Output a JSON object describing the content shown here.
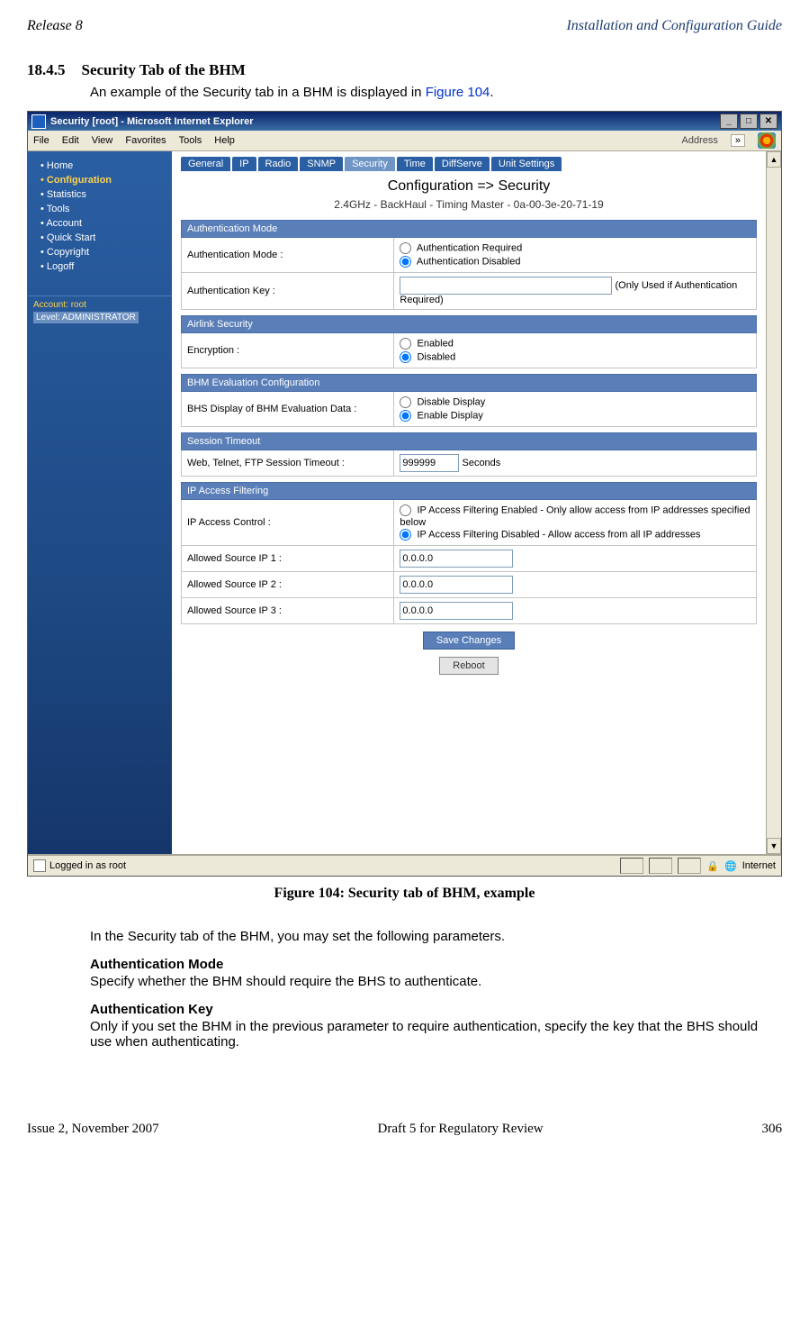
{
  "header": {
    "left": "Release 8",
    "right": "Installation and Configuration Guide"
  },
  "footer": {
    "left": "Issue 2, November 2007",
    "center": "Draft 5 for Regulatory Review",
    "right": "306"
  },
  "section": {
    "number": "18.4.5",
    "title": "Security Tab of the BHM",
    "intro_pre": "An example of the Security tab in a BHM is displayed in ",
    "intro_link": "Figure 104",
    "intro_post": "."
  },
  "figure_caption": "Figure 104: Security tab of BHM, example",
  "after_fig": "In the Security tab of the BHM, you may set the following parameters.",
  "params": [
    {
      "head": "Authentication Mode",
      "body": "Specify whether the BHM should require the BHS to authenticate."
    },
    {
      "head": "Authentication Key",
      "body": "Only if you set the BHM in the previous parameter to require authentication, specify the key that the BHS should use when authenticating."
    }
  ],
  "browser": {
    "title": "Security [root] - Microsoft Internet Explorer",
    "menus": [
      "File",
      "Edit",
      "View",
      "Favorites",
      "Tools",
      "Help"
    ],
    "address_label": "Address",
    "status_left": "Logged in as root",
    "status_right": "Internet"
  },
  "sidebar": {
    "items": [
      {
        "label": "Home"
      },
      {
        "label": "Configuration",
        "selected": true
      },
      {
        "label": "Statistics"
      },
      {
        "label": "Tools"
      },
      {
        "label": "Account"
      },
      {
        "label": "Quick Start"
      },
      {
        "label": "Copyright"
      },
      {
        "label": "Logoff"
      }
    ],
    "account_line": "Account: root",
    "level_line": "Level: ADMINISTRATOR"
  },
  "tabs": [
    "General",
    "IP",
    "Radio",
    "SNMP",
    "Security",
    "Time",
    "DiffServe",
    "Unit Settings"
  ],
  "tab_selected": "Security",
  "page": {
    "title": "Configuration => Security",
    "subtitle": "2.4GHz - BackHaul - Timing Master - 0a-00-3e-20-71-19"
  },
  "panels": {
    "auth_mode": {
      "header": "Authentication Mode",
      "row1_label": "Authentication Mode :",
      "opt1": "Authentication Required",
      "opt2": "Authentication Disabled",
      "row2_label": "Authentication Key :",
      "row2_suffix": "(Only Used if Authentication Required)",
      "key_value": ""
    },
    "airlink": {
      "header": "Airlink Security",
      "row_label": "Encryption :",
      "opt1": "Enabled",
      "opt2": "Disabled"
    },
    "bhm_eval": {
      "header": "BHM Evaluation Configuration",
      "row_label": "BHS Display of BHM Evaluation Data :",
      "opt1": "Disable Display",
      "opt2": "Enable Display"
    },
    "session": {
      "header": "Session Timeout",
      "row_label": "Web, Telnet, FTP Session Timeout :",
      "value": "999999",
      "suffix": "Seconds"
    },
    "ip_filter": {
      "header": "IP Access Filtering",
      "row1_label": "IP Access Control :",
      "opt1": "IP Access Filtering Enabled - Only allow access from IP addresses specified below",
      "opt2": "IP Access Filtering Disabled - Allow access from all IP addresses",
      "src1_label": "Allowed Source IP 1 :",
      "src1_val": "0.0.0.0",
      "src2_label": "Allowed Source IP 2 :",
      "src2_val": "0.0.0.0",
      "src3_label": "Allowed Source IP 3 :",
      "src3_val": "0.0.0.0"
    }
  },
  "buttons": {
    "save": "Save Changes",
    "reboot": "Reboot"
  }
}
